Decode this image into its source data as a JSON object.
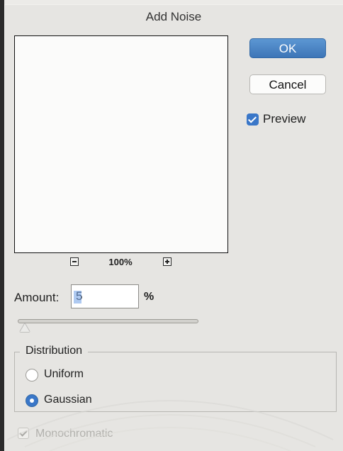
{
  "dialog": {
    "title": "Add Noise"
  },
  "buttons": {
    "ok_label": "OK",
    "cancel_label": "Cancel"
  },
  "preview": {
    "label": "Preview",
    "checked": true
  },
  "zoom": {
    "level": "100%"
  },
  "amount": {
    "label": "Amount:",
    "value": "5",
    "unit": "%",
    "slider_fraction": 0.0
  },
  "distribution": {
    "label": "Distribution",
    "options": [
      {
        "label": "Uniform",
        "selected": false
      },
      {
        "label": "Gaussian",
        "selected": true
      }
    ]
  },
  "monochromatic": {
    "label": "Monochromatic",
    "checked": true,
    "disabled": true
  },
  "colors": {
    "accent": "#3a77c8",
    "dialog_bg": "#e6e5e2"
  },
  "icons": {
    "zoom_out": "minus-icon",
    "zoom_in": "plus-icon",
    "checkmark": "checkmark-icon"
  }
}
